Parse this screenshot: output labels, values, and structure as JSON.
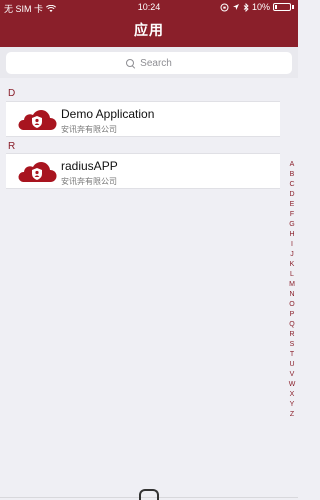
{
  "status_bar": {
    "carrier": "无 SIM 卡",
    "time": "10:24",
    "battery": "10%"
  },
  "header": {
    "title": "应用"
  },
  "search": {
    "placeholder": "Search"
  },
  "sections": [
    {
      "letter": "D",
      "items": [
        {
          "name": "Demo Application",
          "company": "安讯奔有限公司",
          "icon": "cloud-shield-icon"
        }
      ]
    },
    {
      "letter": "R",
      "items": [
        {
          "name": "radiusAPP",
          "company": "安讯奔有限公司",
          "icon": "cloud-shield-icon"
        }
      ]
    }
  ],
  "index": [
    "A",
    "B",
    "C",
    "D",
    "E",
    "F",
    "G",
    "H",
    "I",
    "J",
    "K",
    "L",
    "M",
    "N",
    "O",
    "P",
    "Q",
    "R",
    "S",
    "T",
    "U",
    "V",
    "W",
    "X",
    "Y",
    "Z"
  ],
  "colors": {
    "brand": "#8a1f2a",
    "background": "#efeff4"
  }
}
